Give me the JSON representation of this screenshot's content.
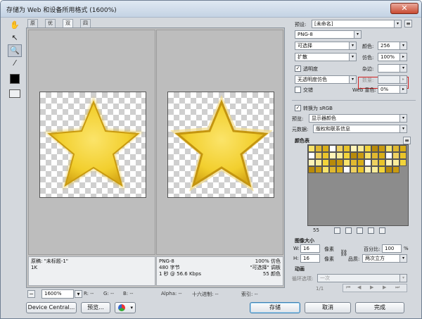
{
  "window": {
    "title": "存储为 Web 和设备所用格式 (1600%)",
    "close_glyph": "✕"
  },
  "tools": [
    {
      "name": "hand-tool",
      "glyph": "✋"
    },
    {
      "name": "slice-select-tool",
      "glyph": "↖"
    },
    {
      "name": "zoom-tool",
      "glyph": "🔍"
    },
    {
      "name": "eyedropper-tool",
      "glyph": "⁄"
    }
  ],
  "tabs": [
    "原稿",
    "优化",
    "双联",
    "四联"
  ],
  "pane_left_info": {
    "line1": "原稿: \"未标题-1\"",
    "line2": "1K"
  },
  "pane_right_info": {
    "line1": "PNG-8",
    "line2": "480 字节",
    "line3": "1 秒 @ 56.6 Kbps",
    "r1": "100% 仿色",
    "r2": "\"可选择\" 调板",
    "r3": "55 颜色"
  },
  "status": {
    "zoom": "1600%",
    "r": "R: --",
    "g": "G: --",
    "b": "B: --",
    "alpha": "Alpha: --",
    "hex": "十六进制: --",
    "index": "索引: --"
  },
  "panel": {
    "preset_label": "预设:",
    "preset_value": "[未命名]",
    "format_value": "PNG-8",
    "reduction_value": "可选择",
    "colors_label": "颜色:",
    "colors_value": "256",
    "dither_value": "扩散",
    "dither_label": "仿色:",
    "dither_amount": "100%",
    "transparency_label": "透明度",
    "matte_label": "杂边:",
    "trans_dither_value": "无透明度仿色",
    "amount_label": "数量:",
    "interlaced_label": "交错",
    "websnap_label": "Web 靠色:",
    "websnap_value": "0%",
    "srgb_label": "转换为 sRGB",
    "preview_label": "预览:",
    "preview_value": "显示器颜色",
    "metadata_label": "元数据:",
    "metadata_value": "版权和联系信息",
    "color_table_label": "颜色表",
    "color_count": "55",
    "image_size_label": "图像大小",
    "w_label": "W:",
    "w_value": "16",
    "h_label": "H:",
    "h_value": "16",
    "px_unit": "像素",
    "percent_label": "百分比:",
    "percent_value": "100",
    "percent_unit": "%",
    "quality_label": "品质:",
    "quality_value": "两次立方",
    "animation_label": "动画",
    "loop_label": "循环选项:",
    "loop_value": "一次",
    "frame_counter": "1/1"
  },
  "buttons": {
    "device_central": "Device Central...",
    "preview": "预览...",
    "save": "存储",
    "cancel": "取消",
    "done": "完成"
  },
  "colors": {
    "star_outer": "#e3b92a",
    "star_inner": "#f7d94a",
    "star_shadow": "#c99a10",
    "highlight_red": "#d42020"
  }
}
